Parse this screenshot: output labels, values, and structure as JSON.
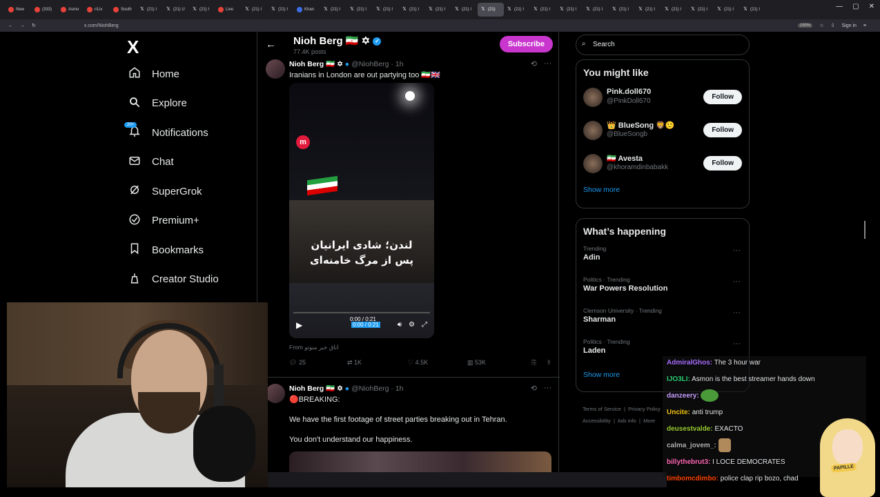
{
  "browser": {
    "tabs": [
      {
        "label": "New",
        "icon": "red"
      },
      {
        "label": "(333)",
        "icon": "red"
      },
      {
        "label": "Asmo",
        "icon": "red"
      },
      {
        "label": "r/Liv",
        "icon": "red"
      },
      {
        "label": "South",
        "icon": "red"
      },
      {
        "label": "(21) I",
        "icon": "x"
      },
      {
        "label": "(21) U",
        "icon": "x"
      },
      {
        "label": "(21) I",
        "icon": "x"
      },
      {
        "label": "Live",
        "icon": "red"
      },
      {
        "label": "(21) I",
        "icon": "x"
      },
      {
        "label": "(21) I",
        "icon": "x"
      },
      {
        "label": "Khan",
        "icon": "blue"
      },
      {
        "label": "(21) I",
        "icon": "x"
      },
      {
        "label": "(21) I",
        "icon": "x"
      },
      {
        "label": "(21) I",
        "icon": "x"
      },
      {
        "label": "(21) I",
        "icon": "x"
      },
      {
        "label": "(21) I",
        "icon": "x"
      },
      {
        "label": "(21) I",
        "icon": "x"
      },
      {
        "label": "(21)",
        "icon": "x",
        "active": true
      },
      {
        "label": "(21) I",
        "icon": "x"
      },
      {
        "label": "(21) I",
        "icon": "x"
      },
      {
        "label": "(21) I",
        "icon": "x"
      },
      {
        "label": "(21) I",
        "icon": "x"
      },
      {
        "label": "(21) I",
        "icon": "x"
      },
      {
        "label": "(21) I",
        "icon": "x"
      },
      {
        "label": "(21) I",
        "icon": "x"
      },
      {
        "label": "(21) I",
        "icon": "x"
      },
      {
        "label": "(21) I",
        "icon": "x"
      },
      {
        "label": "(21) I",
        "icon": "x"
      }
    ],
    "url": "x.com/NiohBerg",
    "zoom": "150%",
    "sign_in": "Sign in"
  },
  "nav": {
    "logo": "X",
    "items": [
      {
        "label": "Home",
        "icon": "home-icon"
      },
      {
        "label": "Explore",
        "icon": "search-icon"
      },
      {
        "label": "Notifications",
        "icon": "bell-icon",
        "badge": "20+"
      },
      {
        "label": "Chat",
        "icon": "mail-icon"
      },
      {
        "label": "SuperGrok",
        "icon": "grok-icon"
      },
      {
        "label": "Premium+",
        "icon": "premium-icon"
      },
      {
        "label": "Bookmarks",
        "icon": "bookmark-icon"
      },
      {
        "label": "Creator Studio",
        "icon": "creator-icon"
      }
    ]
  },
  "profile": {
    "name": "Nioh Berg 🇮🇷 ✡",
    "posts": "77.4K posts",
    "subscribe": "Subscribe"
  },
  "tweets": [
    {
      "name": "Nioh Berg 🇮🇷 ✡",
      "handle": "@NiohBerg · 1h",
      "text": "Iranians in London are out partying too 🇮🇷🇬🇧",
      "media_caption_1": "لندن؛ شادی ایرانیان",
      "media_caption_2": "پس از مرگ خامنه‌ای",
      "media_logo": "m",
      "time_top": "0:00 / 0:21",
      "time": "0:00 / 0:21",
      "from": "From اتاق خبر منوتو",
      "replies": "25",
      "reposts": "1K",
      "likes": "4.5K",
      "views": "53K"
    },
    {
      "name": "Nioh Berg 🇮🇷 ✡",
      "handle": "@NiohBerg · 1h",
      "line1": "🔴BREAKING:",
      "line2": "We have the first footage of street parties breaking out in Tehran.",
      "line3": "You don't understand our happiness."
    }
  ],
  "right": {
    "search_placeholder": "Search",
    "might_like_title": "You might like",
    "might_like": [
      {
        "name": "Pink.doll670",
        "handle": "@PinkDoll670",
        "follow": "Follow"
      },
      {
        "name": "👑 BlueSong 🦁🙂",
        "handle": "@BlueSongb",
        "follow": "Follow"
      },
      {
        "name": "🇮🇷 Avesta",
        "handle": "@khoramdinbabakk",
        "follow": "Follow"
      }
    ],
    "show_more_1": "Show more",
    "happening_title": "What’s happening",
    "trends": [
      {
        "context": "Trending",
        "title": "Adin"
      },
      {
        "context": "Politics · Trending",
        "title": "War Powers Resolution"
      },
      {
        "context": "Clemson University · Trending",
        "title": "Sharman"
      },
      {
        "context": "Politics · Trending",
        "title": "Laden"
      }
    ],
    "show_more_2": "Show more",
    "footer": [
      "Terms of Service",
      "Privacy Policy",
      "Accessibility",
      "Ads info",
      "More"
    ]
  },
  "chat": [
    {
      "user": "AdmiralGhos:",
      "color": "#a970ff",
      "msg": "The 3 hour war"
    },
    {
      "user": "IJO3LI:",
      "color": "#2ecc71",
      "msg": "Asmon is the best streamer hands down"
    },
    {
      "user": "danzeery:",
      "color": "#c9a0ff",
      "msg": "",
      "emote": "pepe"
    },
    {
      "user": "Uncite:",
      "color": "#f1c40f",
      "msg": "anti trump"
    },
    {
      "user": "deusestvalde:",
      "color": "#9acd32",
      "msg": "EXACTO"
    },
    {
      "user": "calma_jovem_:",
      "color": "#b0b0b0",
      "msg": "",
      "emote": "emote2"
    },
    {
      "user": "billythebrut3:",
      "color": "#ff69b4",
      "msg": "I LOCE DEMOCRATES"
    },
    {
      "user": "timbomcdimbo:",
      "color": "#ff4500",
      "msg": "police clap rip bozo, chad"
    }
  ],
  "streamer_badge": "PAPILLE",
  "colors": {
    "accent": "#1d9bf0",
    "subscribe": "#c936ce",
    "bg": "#000000"
  }
}
